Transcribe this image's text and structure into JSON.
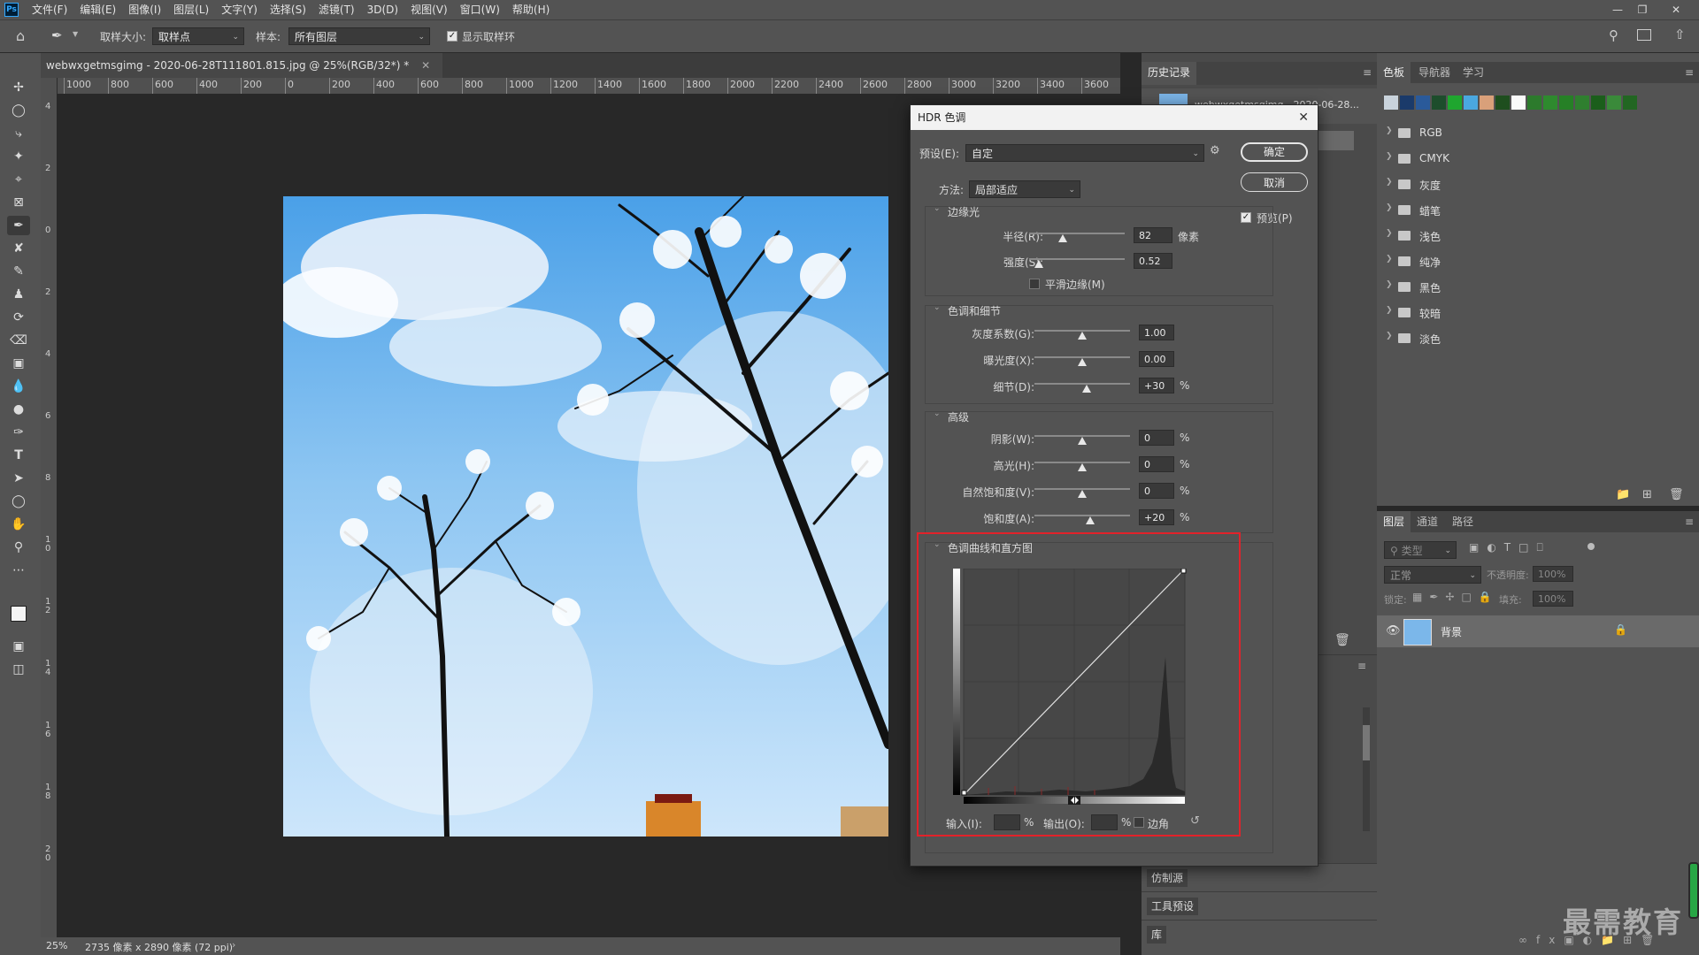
{
  "menubar": {
    "app_icon": "Ps",
    "items": [
      "文件(F)",
      "编辑(E)",
      "图像(I)",
      "图层(L)",
      "文字(Y)",
      "选择(S)",
      "滤镜(T)",
      "3D(D)",
      "视图(V)",
      "窗口(W)",
      "帮助(H)"
    ],
    "window_controls": [
      "minimize-icon",
      "restore-icon",
      "close-icon"
    ]
  },
  "options_bar": {
    "sample_size_label": "取样大小:",
    "sample_size_value": "取样点",
    "sample_label": "样本:",
    "sample_value": "所有图层",
    "show_ring_label": "显示取样环",
    "show_ring_checked": true
  },
  "document": {
    "tab_title": "webwxgetmsgimg - 2020-06-28T111801.815.jpg @ 25%(RGB/32*) *",
    "ruler_ticks": [
      "1000",
      "800",
      "600",
      "400",
      "200",
      "0",
      "200",
      "400",
      "600",
      "800",
      "1000",
      "1200",
      "1400",
      "1600",
      "1800",
      "2000",
      "2200",
      "2400",
      "2600",
      "2800",
      "3000",
      "3200",
      "3400",
      "3600"
    ],
    "vruler_ticks": [
      "4",
      "2",
      "0",
      "2",
      "4",
      "6",
      "8",
      "1 0",
      "1 2",
      "1 4",
      "1 6",
      "1 8",
      "2 0"
    ],
    "zoom": "25%",
    "doc_info": "2735 像素 x 2890 像素 (72 ppi)"
  },
  "panels_mid": {
    "history_tab": "历史记录",
    "history_item": "webwxgetmsgimg - 2020-06-28...",
    "clone_source_tab": "仿制源",
    "tool_presets_tab": "工具预设",
    "library_tab": "库"
  },
  "swatches_panel": {
    "tabs": [
      "色板",
      "导航器",
      "学习"
    ],
    "colors": [
      "#c9d3dc",
      "#1a3a6a",
      "#2a5a9a",
      "#1d4d2c",
      "#1fa62f",
      "#4aa8e0",
      "#d9a07a",
      "#1e4e1e",
      "#fafafa",
      "#2c7a2c",
      "#2e8a2e",
      "#268026",
      "#2f7f2f",
      "#1b5e1b",
      "#3a8a3a",
      "#226622"
    ],
    "groups": [
      "RGB",
      "CMYK",
      "灰度",
      "蜡笔",
      "浅色",
      "纯净",
      "黑色",
      "较暗",
      "淡色"
    ]
  },
  "layers_panel": {
    "tabs": [
      "图层",
      "通道",
      "路径"
    ],
    "filter_placeholder": "类型",
    "blend_mode": "正常",
    "opacity_label": "不透明度:",
    "opacity_value": "100%",
    "lock_label": "锁定:",
    "fill_label": "填充:",
    "fill_value": "100%",
    "layer_name": "背景"
  },
  "watermark": "最需教育",
  "hdr_dialog": {
    "title": "HDR 色调",
    "preset_label": "预设(E):",
    "preset_value": "自定",
    "ok_label": "确定",
    "cancel_label": "取消",
    "preview_label": "预览(P)",
    "preview_checked": true,
    "method_label": "方法:",
    "method_value": "局部适应",
    "edge_glow": {
      "header": "边缘光",
      "radius_label": "半径(R):",
      "radius_value": "82",
      "radius_unit": "像素",
      "radius_level": 0.35,
      "strength_label": "强度(S):",
      "strength_value": "0.52",
      "strength_level": 0.1,
      "smooth_label": "平滑边缘(M)"
    },
    "tone_detail": {
      "header": "色调和细节",
      "gamma_label": "灰度系数(G):",
      "gamma_value": "1.00",
      "gamma_level": 0.5,
      "exposure_label": "曝光度(X):",
      "exposure_value": "0.00",
      "exposure_level": 0.5,
      "detail_label": "细节(D):",
      "detail_value": "+30",
      "detail_level": 0.55,
      "percent": "%"
    },
    "advanced": {
      "header": "高级",
      "shadow_label": "阴影(W):",
      "shadow_value": "0",
      "shadow_level": 0.5,
      "highlight_label": "高光(H):",
      "highlight_value": "0",
      "highlight_level": 0.5,
      "vibrance_label": "自然饱和度(V):",
      "vibrance_value": "0",
      "vibrance_level": 0.5,
      "saturation_label": "饱和度(A):",
      "saturation_value": "+20",
      "saturation_level": 0.58,
      "percent": "%"
    },
    "curve": {
      "header": "色调曲线和直方图",
      "input_label": "输入(I):",
      "output_label": "输出(O):",
      "corner_label": "边角",
      "percent": "%"
    }
  }
}
